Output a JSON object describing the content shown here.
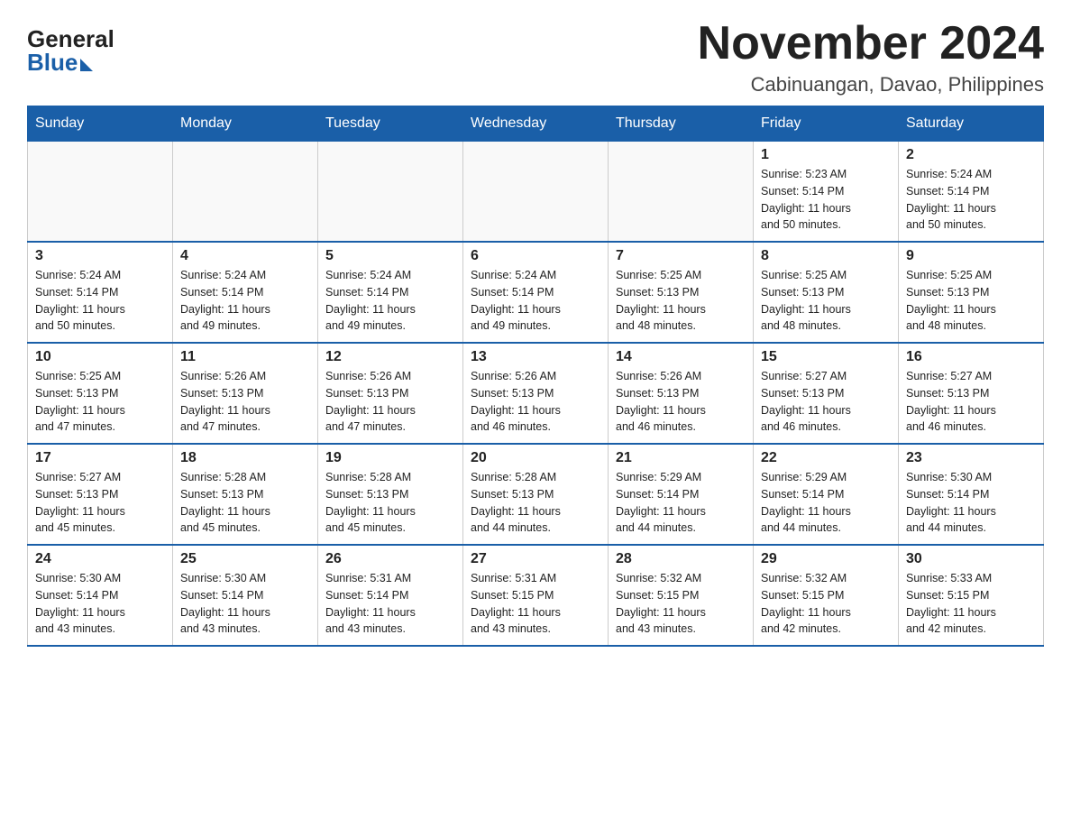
{
  "logo": {
    "general": "General",
    "blue": "Blue"
  },
  "title": "November 2024",
  "subtitle": "Cabinuangan, Davao, Philippines",
  "calendar": {
    "headers": [
      "Sunday",
      "Monday",
      "Tuesday",
      "Wednesday",
      "Thursday",
      "Friday",
      "Saturday"
    ],
    "weeks": [
      [
        {
          "day": "",
          "info": ""
        },
        {
          "day": "",
          "info": ""
        },
        {
          "day": "",
          "info": ""
        },
        {
          "day": "",
          "info": ""
        },
        {
          "day": "",
          "info": ""
        },
        {
          "day": "1",
          "info": "Sunrise: 5:23 AM\nSunset: 5:14 PM\nDaylight: 11 hours\nand 50 minutes."
        },
        {
          "day": "2",
          "info": "Sunrise: 5:24 AM\nSunset: 5:14 PM\nDaylight: 11 hours\nand 50 minutes."
        }
      ],
      [
        {
          "day": "3",
          "info": "Sunrise: 5:24 AM\nSunset: 5:14 PM\nDaylight: 11 hours\nand 50 minutes."
        },
        {
          "day": "4",
          "info": "Sunrise: 5:24 AM\nSunset: 5:14 PM\nDaylight: 11 hours\nand 49 minutes."
        },
        {
          "day": "5",
          "info": "Sunrise: 5:24 AM\nSunset: 5:14 PM\nDaylight: 11 hours\nand 49 minutes."
        },
        {
          "day": "6",
          "info": "Sunrise: 5:24 AM\nSunset: 5:14 PM\nDaylight: 11 hours\nand 49 minutes."
        },
        {
          "day": "7",
          "info": "Sunrise: 5:25 AM\nSunset: 5:13 PM\nDaylight: 11 hours\nand 48 minutes."
        },
        {
          "day": "8",
          "info": "Sunrise: 5:25 AM\nSunset: 5:13 PM\nDaylight: 11 hours\nand 48 minutes."
        },
        {
          "day": "9",
          "info": "Sunrise: 5:25 AM\nSunset: 5:13 PM\nDaylight: 11 hours\nand 48 minutes."
        }
      ],
      [
        {
          "day": "10",
          "info": "Sunrise: 5:25 AM\nSunset: 5:13 PM\nDaylight: 11 hours\nand 47 minutes."
        },
        {
          "day": "11",
          "info": "Sunrise: 5:26 AM\nSunset: 5:13 PM\nDaylight: 11 hours\nand 47 minutes."
        },
        {
          "day": "12",
          "info": "Sunrise: 5:26 AM\nSunset: 5:13 PM\nDaylight: 11 hours\nand 47 minutes."
        },
        {
          "day": "13",
          "info": "Sunrise: 5:26 AM\nSunset: 5:13 PM\nDaylight: 11 hours\nand 46 minutes."
        },
        {
          "day": "14",
          "info": "Sunrise: 5:26 AM\nSunset: 5:13 PM\nDaylight: 11 hours\nand 46 minutes."
        },
        {
          "day": "15",
          "info": "Sunrise: 5:27 AM\nSunset: 5:13 PM\nDaylight: 11 hours\nand 46 minutes."
        },
        {
          "day": "16",
          "info": "Sunrise: 5:27 AM\nSunset: 5:13 PM\nDaylight: 11 hours\nand 46 minutes."
        }
      ],
      [
        {
          "day": "17",
          "info": "Sunrise: 5:27 AM\nSunset: 5:13 PM\nDaylight: 11 hours\nand 45 minutes."
        },
        {
          "day": "18",
          "info": "Sunrise: 5:28 AM\nSunset: 5:13 PM\nDaylight: 11 hours\nand 45 minutes."
        },
        {
          "day": "19",
          "info": "Sunrise: 5:28 AM\nSunset: 5:13 PM\nDaylight: 11 hours\nand 45 minutes."
        },
        {
          "day": "20",
          "info": "Sunrise: 5:28 AM\nSunset: 5:13 PM\nDaylight: 11 hours\nand 44 minutes."
        },
        {
          "day": "21",
          "info": "Sunrise: 5:29 AM\nSunset: 5:14 PM\nDaylight: 11 hours\nand 44 minutes."
        },
        {
          "day": "22",
          "info": "Sunrise: 5:29 AM\nSunset: 5:14 PM\nDaylight: 11 hours\nand 44 minutes."
        },
        {
          "day": "23",
          "info": "Sunrise: 5:30 AM\nSunset: 5:14 PM\nDaylight: 11 hours\nand 44 minutes."
        }
      ],
      [
        {
          "day": "24",
          "info": "Sunrise: 5:30 AM\nSunset: 5:14 PM\nDaylight: 11 hours\nand 43 minutes."
        },
        {
          "day": "25",
          "info": "Sunrise: 5:30 AM\nSunset: 5:14 PM\nDaylight: 11 hours\nand 43 minutes."
        },
        {
          "day": "26",
          "info": "Sunrise: 5:31 AM\nSunset: 5:14 PM\nDaylight: 11 hours\nand 43 minutes."
        },
        {
          "day": "27",
          "info": "Sunrise: 5:31 AM\nSunset: 5:15 PM\nDaylight: 11 hours\nand 43 minutes."
        },
        {
          "day": "28",
          "info": "Sunrise: 5:32 AM\nSunset: 5:15 PM\nDaylight: 11 hours\nand 43 minutes."
        },
        {
          "day": "29",
          "info": "Sunrise: 5:32 AM\nSunset: 5:15 PM\nDaylight: 11 hours\nand 42 minutes."
        },
        {
          "day": "30",
          "info": "Sunrise: 5:33 AM\nSunset: 5:15 PM\nDaylight: 11 hours\nand 42 minutes."
        }
      ]
    ]
  }
}
